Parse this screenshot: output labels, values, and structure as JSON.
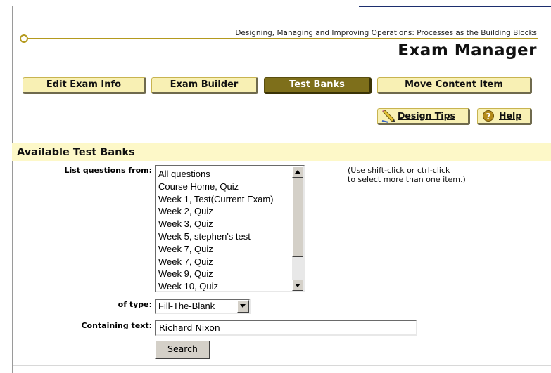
{
  "header": {
    "course_title": "Designing, Managing and Improving Operations: Processes as the Building Blocks",
    "app_title": "Exam Manager"
  },
  "tabs": [
    {
      "label": "Edit Exam Info",
      "active": false
    },
    {
      "label": "Exam Builder",
      "active": false
    },
    {
      "label": "Test Banks",
      "active": true
    },
    {
      "label": "Move Content Item",
      "active": false
    }
  ],
  "utility": {
    "design_tips": "Design Tips",
    "help": "Help",
    "help_icon_glyph": "?"
  },
  "panel": {
    "title": "Available Test Banks",
    "list_label": "List questions from:",
    "list_items": [
      "All questions",
      "Course Home, Quiz",
      "Week 1, Test(Current Exam)",
      "Week 2, Quiz",
      "Week 3, Quiz",
      "Week 5, stephen's test",
      "Week 7, Quiz",
      "Week 7, Quiz",
      "Week 9, Quiz",
      "Week 10, Quiz"
    ],
    "hint_line1": "(Use shift-click or ctrl-click",
    "hint_line2": "to select more than one item.)",
    "type_label": "of type:",
    "type_value": "Fill-The-Blank",
    "text_label": "Containing text:",
    "text_value": "Richard Nixon",
    "search_button": "Search"
  },
  "colors": {
    "tab_bg": "#f8f0b4",
    "tab_active_bg": "#7e6f1b",
    "panel_header_bg": "#fdf8c8",
    "logo_line": "#b49a1e",
    "frame_accent": "#1c2e6e"
  },
  "icons": {
    "design_tips": "pencil-icon",
    "help": "help-icon",
    "logo": "circle-logo-icon",
    "scroll_up": "scroll-up-arrow-icon",
    "scroll_down": "scroll-down-arrow-icon",
    "dropdown": "dropdown-arrow-icon"
  }
}
